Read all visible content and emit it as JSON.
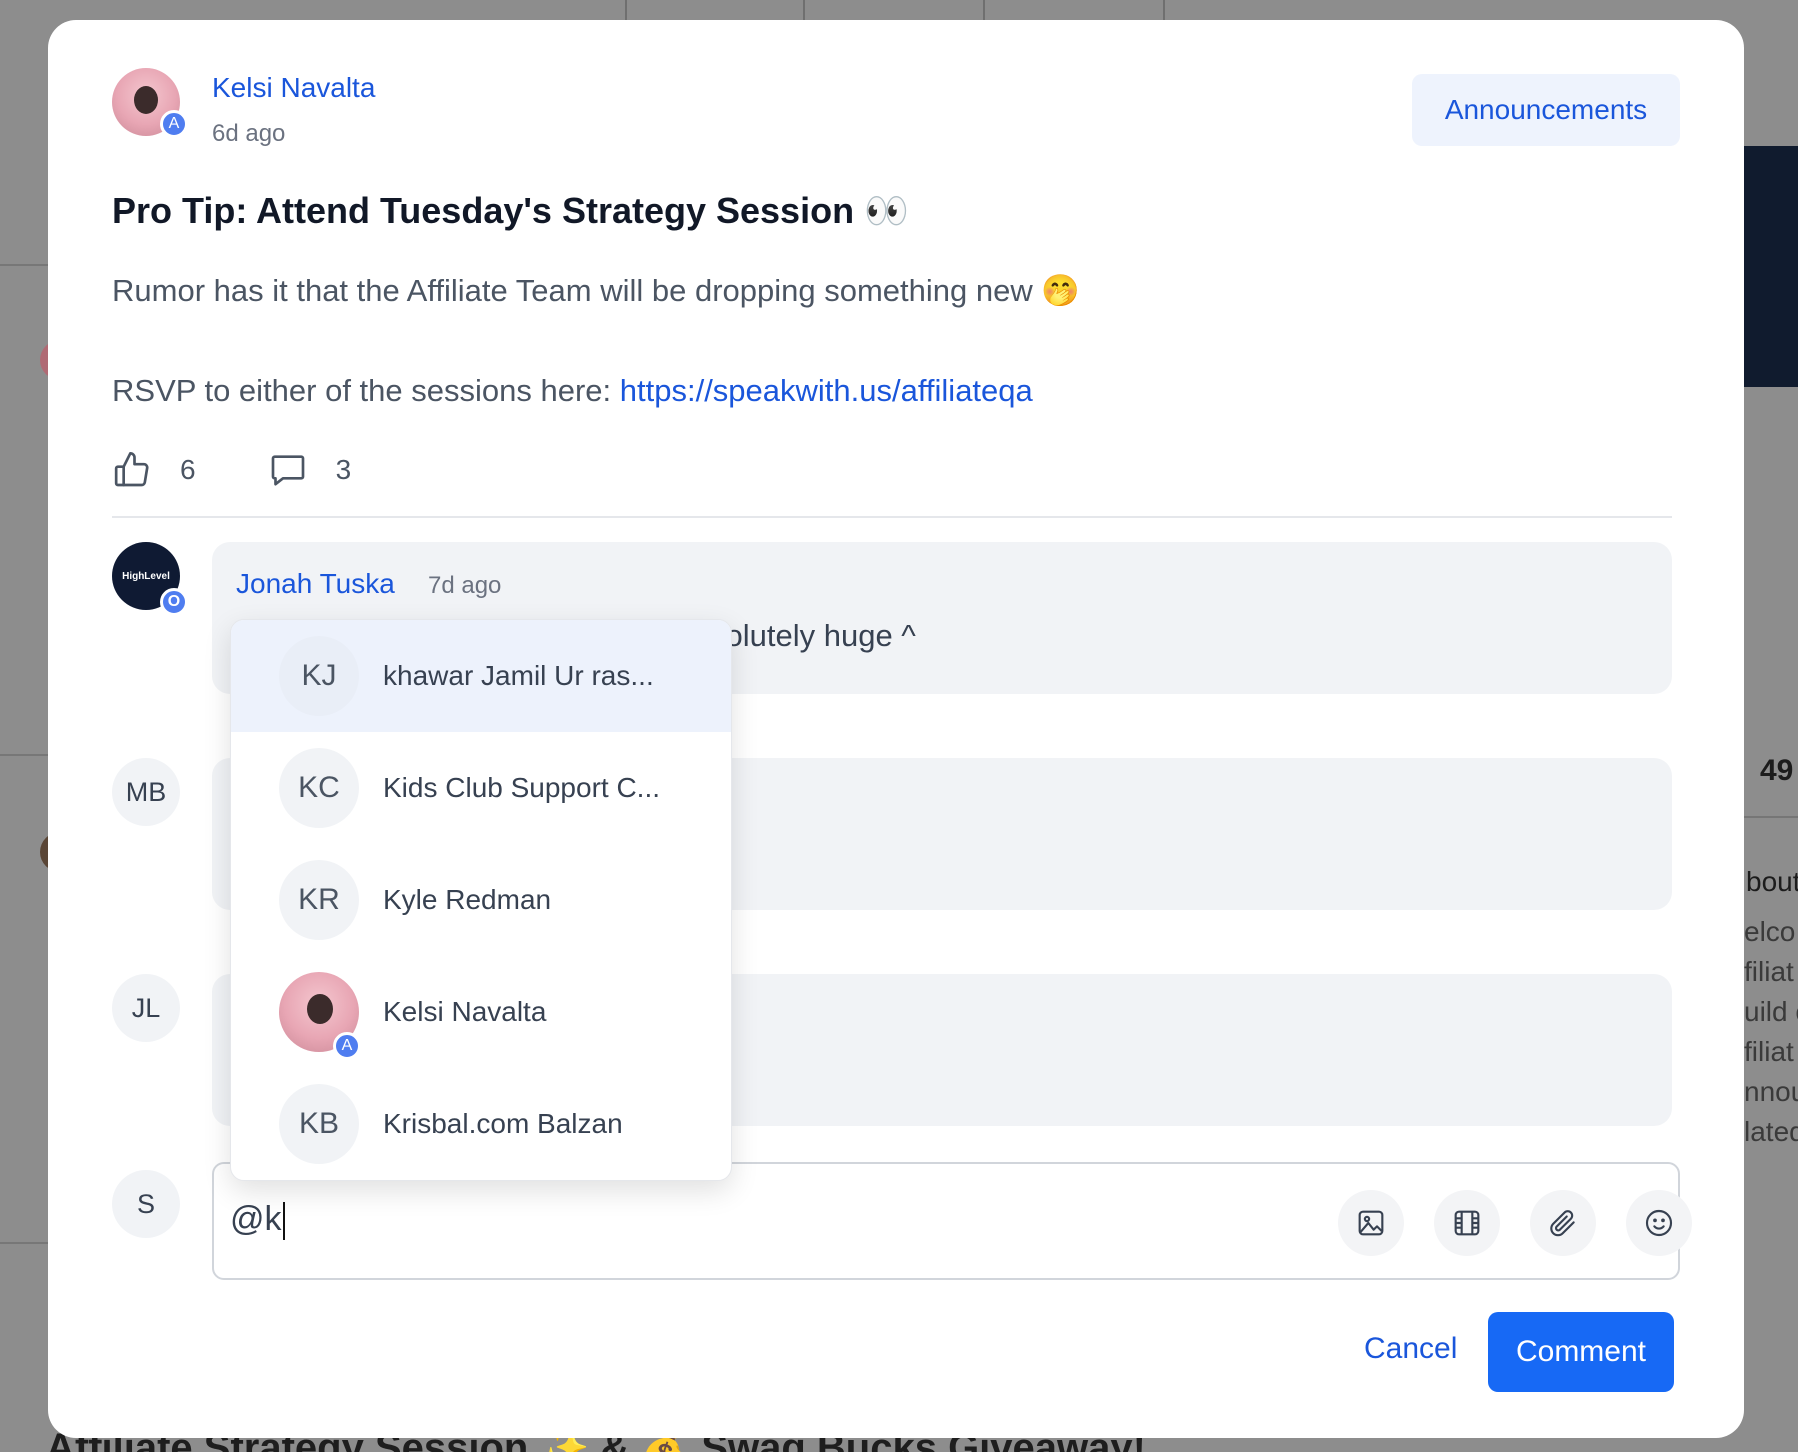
{
  "background": {
    "side_number": "49",
    "side_heading": "bout",
    "side_lines": [
      "elco",
      "filiat",
      "uild c",
      "filiat",
      "nnou",
      "lated"
    ],
    "bottom_title": "Affiliate Strategy Session ✨ & 💰 Swag Bucks Giveaway!"
  },
  "post": {
    "author": "Kelsi Navalta",
    "author_badge": "A",
    "time": "6d ago",
    "category": "Announcements",
    "title": "Pro Tip: Attend Tuesday's Strategy Session 👀",
    "body_line1": "Rumor has it that the Affiliate Team will be dropping something new 🤭",
    "body_line2_prefix": "RSVP to either of the sessions here: ",
    "body_link": "https://speakwith.us/affiliateqa",
    "likes": "6",
    "comments": "3"
  },
  "comments": [
    {
      "avatar_text": "HighLevel",
      "badge": "O",
      "name": "Jonah Tuska",
      "time": "7d ago",
      "text": "colutely huge ^"
    },
    {
      "avatar_text": "MB"
    },
    {
      "avatar_text": "JL"
    }
  ],
  "composer": {
    "user_initial": "S",
    "text": "@k",
    "tools": [
      "image-icon",
      "video-icon",
      "paperclip-icon",
      "emoji-icon"
    ]
  },
  "buttons": {
    "cancel": "Cancel",
    "comment": "Comment"
  },
  "mentions": [
    {
      "initials": "KJ",
      "name": "khawar Jamil Ur ras...",
      "active": true
    },
    {
      "initials": "KC",
      "name": "Kids Club Support C..."
    },
    {
      "initials": "KR",
      "name": "Kyle Redman"
    },
    {
      "initials": "",
      "badge": "A",
      "name": "Kelsi Navalta",
      "photo": true
    },
    {
      "initials": "KB",
      "name": "Krisbal.com Balzan"
    }
  ],
  "colors": {
    "accent": "#1a56db",
    "primary_button": "#1769f5",
    "badge": "#4f7df0"
  }
}
